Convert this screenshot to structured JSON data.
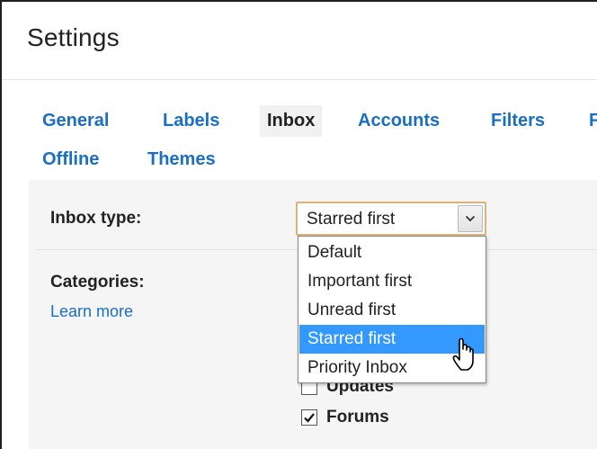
{
  "header": {
    "title": "Settings"
  },
  "tabs": [
    {
      "label": "General"
    },
    {
      "label": "Labels"
    },
    {
      "label": "Inbox",
      "active": true
    },
    {
      "label": "Accounts"
    },
    {
      "label": "Filters"
    },
    {
      "label": "F"
    },
    {
      "label": "Offline"
    },
    {
      "label": "Themes"
    }
  ],
  "inbox_type": {
    "label": "Inbox type:",
    "selected_value": "Starred first",
    "options": [
      {
        "label": "Default"
      },
      {
        "label": "Important first"
      },
      {
        "label": "Unread first"
      },
      {
        "label": "Starred first",
        "selected": true
      },
      {
        "label": "Priority Inbox"
      }
    ]
  },
  "categories": {
    "label": "Categories:",
    "learn_more": "Learn more",
    "items": [
      {
        "label": "Updates",
        "checked": false
      },
      {
        "label": "Forums",
        "checked": true
      }
    ]
  },
  "colors": {
    "link": "#1a6fc4",
    "selected_option": "#3399ff",
    "panel_bg": "#f5f5f5",
    "select_border": "#e0b27a"
  },
  "icons": {
    "select_arrow": "chevron-down-icon",
    "checkmark": "checkmark-icon",
    "cursor": "mouse-pointer-icon"
  }
}
